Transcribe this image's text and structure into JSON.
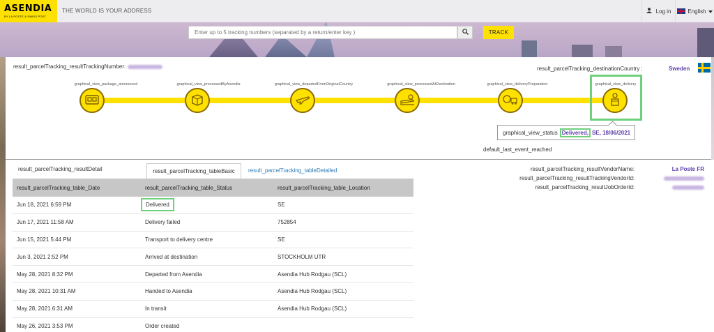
{
  "header": {
    "logo_name": "ASENDIA",
    "logo_tag": "BY LA POSTE & SWISS POST",
    "tagline": "THE WORLD IS YOUR ADDRESS",
    "login_label": "Log in",
    "language_label": "English"
  },
  "search": {
    "placeholder": "Enter up to 5 tracking numbers (separated by a return/enter key )",
    "track_label": "TRACK"
  },
  "tracking": {
    "number_label": "result_parcelTracking_resultTrackingNumber:",
    "destination_label": "result_parcelTracking_destinationCountry :",
    "destination_value": "Sweden",
    "steps": [
      "graphical_view_package_announced",
      "graphical_view_processedByAsendia",
      "graphical_view_departedFromOriginalCountry",
      "graphical_view_processedAtDestination",
      "graphical_view_deliveryPreparation",
      "graphical_view_delivery"
    ],
    "tooltip_label": "graphical_view_status",
    "tooltip_status": "Delivered,",
    "tooltip_rest": "SE, 18/06/2021",
    "last_event": "default_last_event_reached"
  },
  "details": {
    "title": "result_parcelTracking_resultDetail",
    "tab_basic": "result_parcelTracking_tableBasic",
    "tab_detailed": "result_parcelTracking_tableDetailed",
    "columns": [
      "result_parcelTracking_table_Date",
      "result_parcelTracking_table_Status",
      "result_parcelTracking_table_Location"
    ],
    "rows": [
      [
        "Jun 18, 2021 6:59 PM",
        "Delivered",
        "SE"
      ],
      [
        "Jun 17, 2021 11:58 AM",
        "Delivery failed",
        "752854"
      ],
      [
        "Jun 15, 2021 5:44 PM",
        "Transport to delivery centre",
        "SE"
      ],
      [
        "Jun 3, 2021 2:52 PM",
        "Arrived at destination",
        "STOCKHOLM UTR"
      ],
      [
        "May 28, 2021 8:32 PM",
        "Departed from Asendia",
        "Asendia Hub Rodgau (SCL)"
      ],
      [
        "May 28, 2021 10:31 AM",
        "Handed to Asendia",
        "Asendia Hub Rodgau (SCL)"
      ],
      [
        "May 28, 2021 6:31 AM",
        "In transit",
        "Asendia Hub Rodgau (SCL)"
      ],
      [
        "May 26, 2021 3:53 PM",
        "Order created",
        ""
      ]
    ]
  },
  "vendor": {
    "name_label": "result_parcelTracking_resultVendorName:",
    "name_value": "La Poste FR",
    "tracking_id_label": "result_parcelTracking_resultTrackingVendorId:",
    "job_order_label": "result_parcelTracking_resultJobOrderId:"
  },
  "colors": {
    "brand_yellow": "#ffe100",
    "accent_purple": "#5b3da8",
    "highlight_green": "#6ed07a",
    "link_blue": "#2a7ab8"
  }
}
